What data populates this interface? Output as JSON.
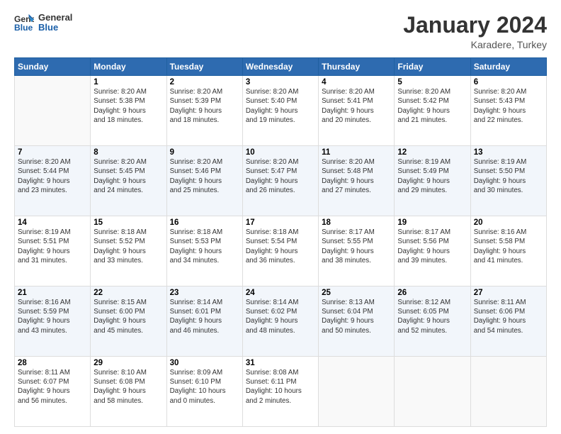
{
  "logo": {
    "line1": "General",
    "line2": "Blue"
  },
  "title": "January 2024",
  "subtitle": "Karadere, Turkey",
  "days_of_week": [
    "Sunday",
    "Monday",
    "Tuesday",
    "Wednesday",
    "Thursday",
    "Friday",
    "Saturday"
  ],
  "weeks": [
    [
      {
        "day": "",
        "info": ""
      },
      {
        "day": "1",
        "info": "Sunrise: 8:20 AM\nSunset: 5:38 PM\nDaylight: 9 hours\nand 18 minutes."
      },
      {
        "day": "2",
        "info": "Sunrise: 8:20 AM\nSunset: 5:39 PM\nDaylight: 9 hours\nand 18 minutes."
      },
      {
        "day": "3",
        "info": "Sunrise: 8:20 AM\nSunset: 5:40 PM\nDaylight: 9 hours\nand 19 minutes."
      },
      {
        "day": "4",
        "info": "Sunrise: 8:20 AM\nSunset: 5:41 PM\nDaylight: 9 hours\nand 20 minutes."
      },
      {
        "day": "5",
        "info": "Sunrise: 8:20 AM\nSunset: 5:42 PM\nDaylight: 9 hours\nand 21 minutes."
      },
      {
        "day": "6",
        "info": "Sunrise: 8:20 AM\nSunset: 5:43 PM\nDaylight: 9 hours\nand 22 minutes."
      }
    ],
    [
      {
        "day": "7",
        "info": "Sunrise: 8:20 AM\nSunset: 5:44 PM\nDaylight: 9 hours\nand 23 minutes."
      },
      {
        "day": "8",
        "info": "Sunrise: 8:20 AM\nSunset: 5:45 PM\nDaylight: 9 hours\nand 24 minutes."
      },
      {
        "day": "9",
        "info": "Sunrise: 8:20 AM\nSunset: 5:46 PM\nDaylight: 9 hours\nand 25 minutes."
      },
      {
        "day": "10",
        "info": "Sunrise: 8:20 AM\nSunset: 5:47 PM\nDaylight: 9 hours\nand 26 minutes."
      },
      {
        "day": "11",
        "info": "Sunrise: 8:20 AM\nSunset: 5:48 PM\nDaylight: 9 hours\nand 27 minutes."
      },
      {
        "day": "12",
        "info": "Sunrise: 8:19 AM\nSunset: 5:49 PM\nDaylight: 9 hours\nand 29 minutes."
      },
      {
        "day": "13",
        "info": "Sunrise: 8:19 AM\nSunset: 5:50 PM\nDaylight: 9 hours\nand 30 minutes."
      }
    ],
    [
      {
        "day": "14",
        "info": "Sunrise: 8:19 AM\nSunset: 5:51 PM\nDaylight: 9 hours\nand 31 minutes."
      },
      {
        "day": "15",
        "info": "Sunrise: 8:18 AM\nSunset: 5:52 PM\nDaylight: 9 hours\nand 33 minutes."
      },
      {
        "day": "16",
        "info": "Sunrise: 8:18 AM\nSunset: 5:53 PM\nDaylight: 9 hours\nand 34 minutes."
      },
      {
        "day": "17",
        "info": "Sunrise: 8:18 AM\nSunset: 5:54 PM\nDaylight: 9 hours\nand 36 minutes."
      },
      {
        "day": "18",
        "info": "Sunrise: 8:17 AM\nSunset: 5:55 PM\nDaylight: 9 hours\nand 38 minutes."
      },
      {
        "day": "19",
        "info": "Sunrise: 8:17 AM\nSunset: 5:56 PM\nDaylight: 9 hours\nand 39 minutes."
      },
      {
        "day": "20",
        "info": "Sunrise: 8:16 AM\nSunset: 5:58 PM\nDaylight: 9 hours\nand 41 minutes."
      }
    ],
    [
      {
        "day": "21",
        "info": "Sunrise: 8:16 AM\nSunset: 5:59 PM\nDaylight: 9 hours\nand 43 minutes."
      },
      {
        "day": "22",
        "info": "Sunrise: 8:15 AM\nSunset: 6:00 PM\nDaylight: 9 hours\nand 45 minutes."
      },
      {
        "day": "23",
        "info": "Sunrise: 8:14 AM\nSunset: 6:01 PM\nDaylight: 9 hours\nand 46 minutes."
      },
      {
        "day": "24",
        "info": "Sunrise: 8:14 AM\nSunset: 6:02 PM\nDaylight: 9 hours\nand 48 minutes."
      },
      {
        "day": "25",
        "info": "Sunrise: 8:13 AM\nSunset: 6:04 PM\nDaylight: 9 hours\nand 50 minutes."
      },
      {
        "day": "26",
        "info": "Sunrise: 8:12 AM\nSunset: 6:05 PM\nDaylight: 9 hours\nand 52 minutes."
      },
      {
        "day": "27",
        "info": "Sunrise: 8:11 AM\nSunset: 6:06 PM\nDaylight: 9 hours\nand 54 minutes."
      }
    ],
    [
      {
        "day": "28",
        "info": "Sunrise: 8:11 AM\nSunset: 6:07 PM\nDaylight: 9 hours\nand 56 minutes."
      },
      {
        "day": "29",
        "info": "Sunrise: 8:10 AM\nSunset: 6:08 PM\nDaylight: 9 hours\nand 58 minutes."
      },
      {
        "day": "30",
        "info": "Sunrise: 8:09 AM\nSunset: 6:10 PM\nDaylight: 10 hours\nand 0 minutes."
      },
      {
        "day": "31",
        "info": "Sunrise: 8:08 AM\nSunset: 6:11 PM\nDaylight: 10 hours\nand 2 minutes."
      },
      {
        "day": "",
        "info": ""
      },
      {
        "day": "",
        "info": ""
      },
      {
        "day": "",
        "info": ""
      }
    ]
  ]
}
